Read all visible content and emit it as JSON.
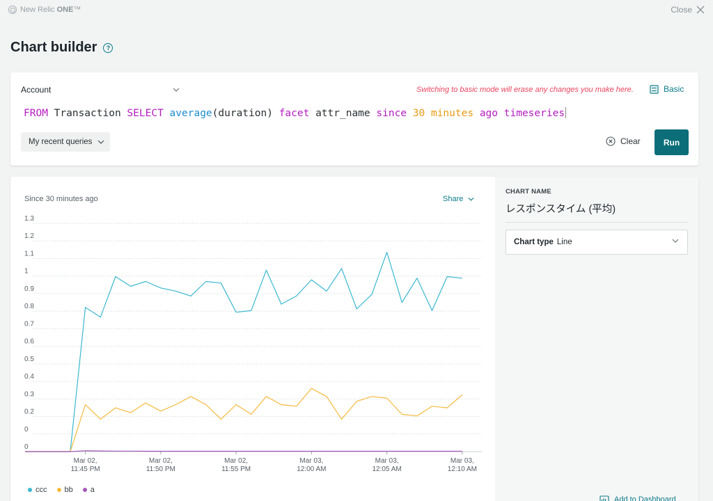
{
  "app": {
    "brand_light": "New Relic ",
    "brand_bold": "ONE",
    "brand_tm": "™",
    "close_label": "Close"
  },
  "page": {
    "title": "Chart builder"
  },
  "query": {
    "account_label": "Account",
    "warning": "Switching to basic mode will erase any changes you make here.",
    "basic_label": "Basic",
    "nrql_tokens": [
      {
        "t": "FROM",
        "c": "kw"
      },
      {
        "t": " Transaction ",
        "c": ""
      },
      {
        "t": "SELECT",
        "c": "kw"
      },
      {
        "t": " ",
        "c": ""
      },
      {
        "t": "average",
        "c": "fn"
      },
      {
        "t": "(duration) ",
        "c": ""
      },
      {
        "t": "facet",
        "c": "kw"
      },
      {
        "t": " attr_name ",
        "c": ""
      },
      {
        "t": "since",
        "c": "kw"
      },
      {
        "t": " ",
        "c": ""
      },
      {
        "t": "30",
        "c": "num"
      },
      {
        "t": " ",
        "c": ""
      },
      {
        "t": "minutes",
        "c": "num"
      },
      {
        "t": " ",
        "c": ""
      },
      {
        "t": "ago",
        "c": "kw"
      },
      {
        "t": " ",
        "c": ""
      },
      {
        "t": "timeseries",
        "c": "kw"
      }
    ],
    "recent_label": "My recent queries",
    "clear_label": "Clear",
    "run_label": "Run"
  },
  "chart_panel": {
    "since_label": "Since 30 minutes ago",
    "share_label": "Share",
    "chart_name_label": "CHART NAME",
    "chart_name": "レスポンスタイム (平均)",
    "chart_type_label": "Chart type",
    "chart_type_value": "Line",
    "add_dashboard_label": "Add to Dashboard"
  },
  "chart_data": {
    "type": "line",
    "title": "",
    "xlabel": "",
    "ylabel": "",
    "ylim": [
      0,
      1.3
    ],
    "y_ticks": [
      "1.3",
      "1.2",
      "1.1",
      "1",
      "0.9",
      "0.8",
      "0.7",
      "0.6",
      "0.5",
      "0.4",
      "0.3",
      "0.2",
      "0",
      "0"
    ],
    "x_tick_labels": [
      [
        "Mar 02,",
        "11:45 PM"
      ],
      [
        "Mar 02,",
        "11:50 PM"
      ],
      [
        "Mar 02,",
        "11:55 PM"
      ],
      [
        "Mar 03,",
        "12:00 AM"
      ],
      [
        "Mar 03,",
        "12:05 AM"
      ],
      [
        "Mar 03,",
        "12:10 AM"
      ]
    ],
    "x": [
      "23:42",
      "23:43",
      "23:44",
      "23:45",
      "23:46",
      "23:47",
      "23:48",
      "23:49",
      "23:50",
      "23:51",
      "23:52",
      "23:53",
      "23:54",
      "23:55",
      "23:56",
      "23:57",
      "23:58",
      "23:59",
      "00:00",
      "00:01",
      "00:02",
      "00:03",
      "00:04",
      "00:05",
      "00:06",
      "00:07",
      "00:08",
      "00:09",
      "00:10",
      "00:11",
      "00:12"
    ],
    "series": [
      {
        "name": "ccc",
        "color": "#3ab7d0",
        "values": [
          0,
          0,
          0,
          0,
          0.89,
          0.83,
          1.08,
          1.02,
          1.05,
          1.01,
          0.99,
          0.96,
          1.05,
          1.04,
          0.86,
          0.87,
          1.12,
          0.91,
          0.96,
          1.06,
          0.99,
          1.13,
          0.88,
          0.97,
          1.23,
          0.92,
          1.07,
          0.87,
          1.08,
          1.07
        ]
      },
      {
        "name": "bb",
        "color": "#f5b93c",
        "values": [
          0,
          0,
          0,
          0,
          0.29,
          0.2,
          0.27,
          0.24,
          0.3,
          0.25,
          0.29,
          0.34,
          0.29,
          0.2,
          0.29,
          0.23,
          0.34,
          0.29,
          0.28,
          0.39,
          0.34,
          0.2,
          0.31,
          0.34,
          0.33,
          0.23,
          0.22,
          0.28,
          0.27,
          0.35
        ]
      },
      {
        "name": "a",
        "color": "#a358b8",
        "values": [
          0,
          0,
          0,
          0,
          0.005,
          0.004,
          0.003,
          0.003,
          0.002,
          0.002,
          0.002,
          0.002,
          0.002,
          0.002,
          0.002,
          0.002,
          0.002,
          0.002,
          0.002,
          0.002,
          0.002,
          0.002,
          0.002,
          0.002,
          0.002,
          0.002,
          0.002,
          0.002,
          0.002,
          0.002
        ]
      }
    ],
    "grid": true,
    "legend_position": "bottom-left"
  }
}
